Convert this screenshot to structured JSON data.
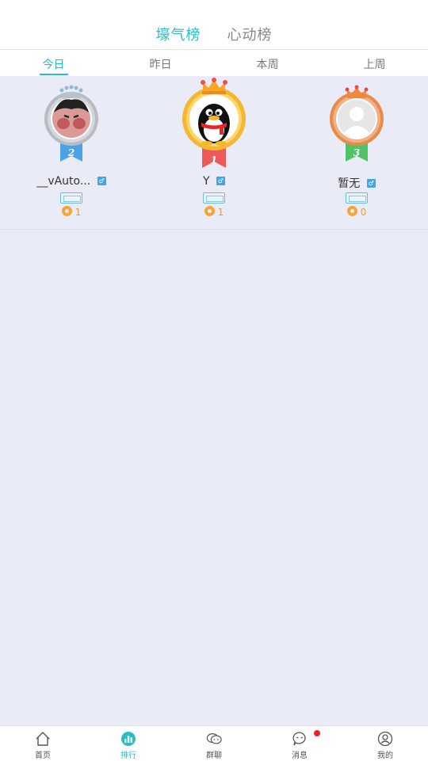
{
  "header": {
    "tabs": [
      {
        "label": "壕气榜",
        "active": true
      },
      {
        "label": "心动榜",
        "active": false
      }
    ]
  },
  "period_tabs": [
    {
      "label": "今日",
      "active": true
    },
    {
      "label": "昨日",
      "active": false
    },
    {
      "label": "本周",
      "active": false
    },
    {
      "label": "上周",
      "active": false
    }
  ],
  "ranking": [
    {
      "rank": "2",
      "name": "__vAuto...",
      "gender": "♂",
      "coins": "1",
      "avatar": "cartoon-face-avatar",
      "medal_color": "#b7bcc4",
      "ribbon_color": "#4aa3e8"
    },
    {
      "rank": "1",
      "name": "Y",
      "gender": "♂",
      "coins": "1",
      "avatar": "qq-penguin-avatar",
      "medal_color": "#f4b731",
      "ribbon_color": "#ec5a5a"
    },
    {
      "rank": "3",
      "name": "暂无",
      "gender": "♂",
      "coins": "0",
      "avatar": "default-user-avatar",
      "medal_color": "#e58c4c",
      "ribbon_color": "#4fc465"
    }
  ],
  "bottom_nav": [
    {
      "label": "首页",
      "icon": "home-icon",
      "active": false
    },
    {
      "label": "排行",
      "icon": "ranking-icon",
      "active": true
    },
    {
      "label": "群聊",
      "icon": "group-chat-icon",
      "active": false
    },
    {
      "label": "消息",
      "icon": "message-icon",
      "active": false,
      "badge": true
    },
    {
      "label": "我的",
      "icon": "profile-icon",
      "active": false
    }
  ],
  "colors": {
    "accent": "#2bbdc6",
    "background": "#e9ecf6",
    "coin": "#f29a3a",
    "badge": "#f2202a"
  }
}
